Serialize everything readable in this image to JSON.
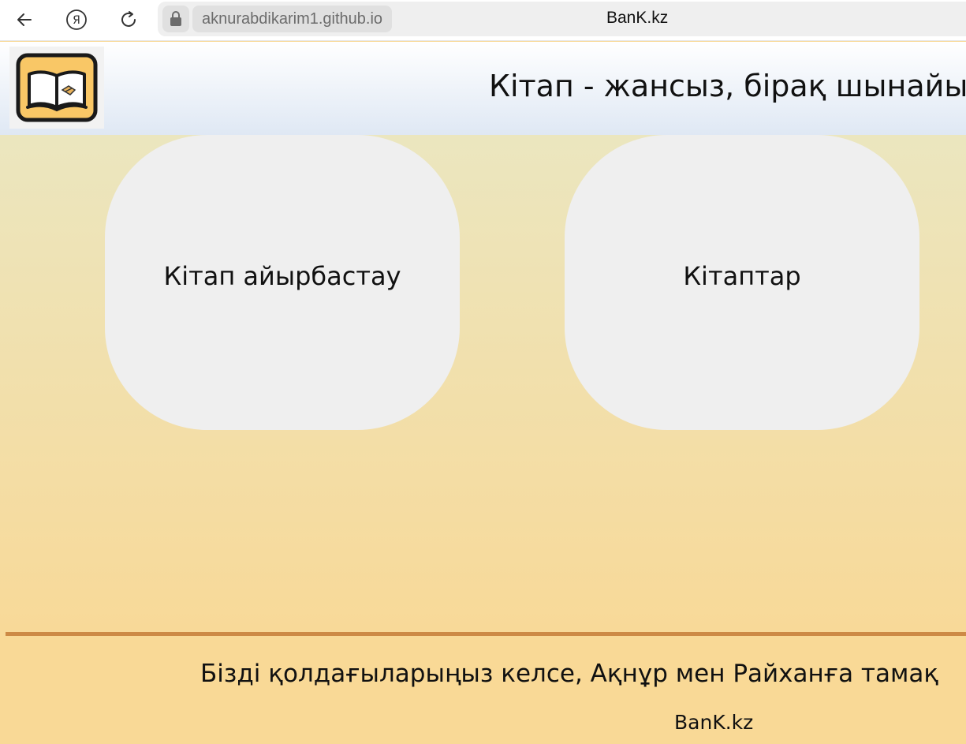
{
  "browser": {
    "url": "aknurabdikarim1.github.io",
    "tab_title": "BanK.kz",
    "icons": [
      "back-arrow-icon",
      "yandex-icon",
      "reload-icon",
      "lock-icon"
    ]
  },
  "header": {
    "logo_icon": "book-handshake-logo",
    "slogan": "Кітап - жансыз, бірақ шынайы"
  },
  "main": {
    "cards": [
      {
        "label": "Кітап айырбастау"
      },
      {
        "label": "Кітаптар"
      }
    ]
  },
  "footer": {
    "text": "Бізді қолдағыларыңыз келсе, Ақнұр мен Райханға тамақ",
    "brand": "BanK.kz"
  },
  "colors": {
    "logo_yellow": "#f9c766",
    "divider": "#cd8a45",
    "card_bg": "#efefef"
  }
}
